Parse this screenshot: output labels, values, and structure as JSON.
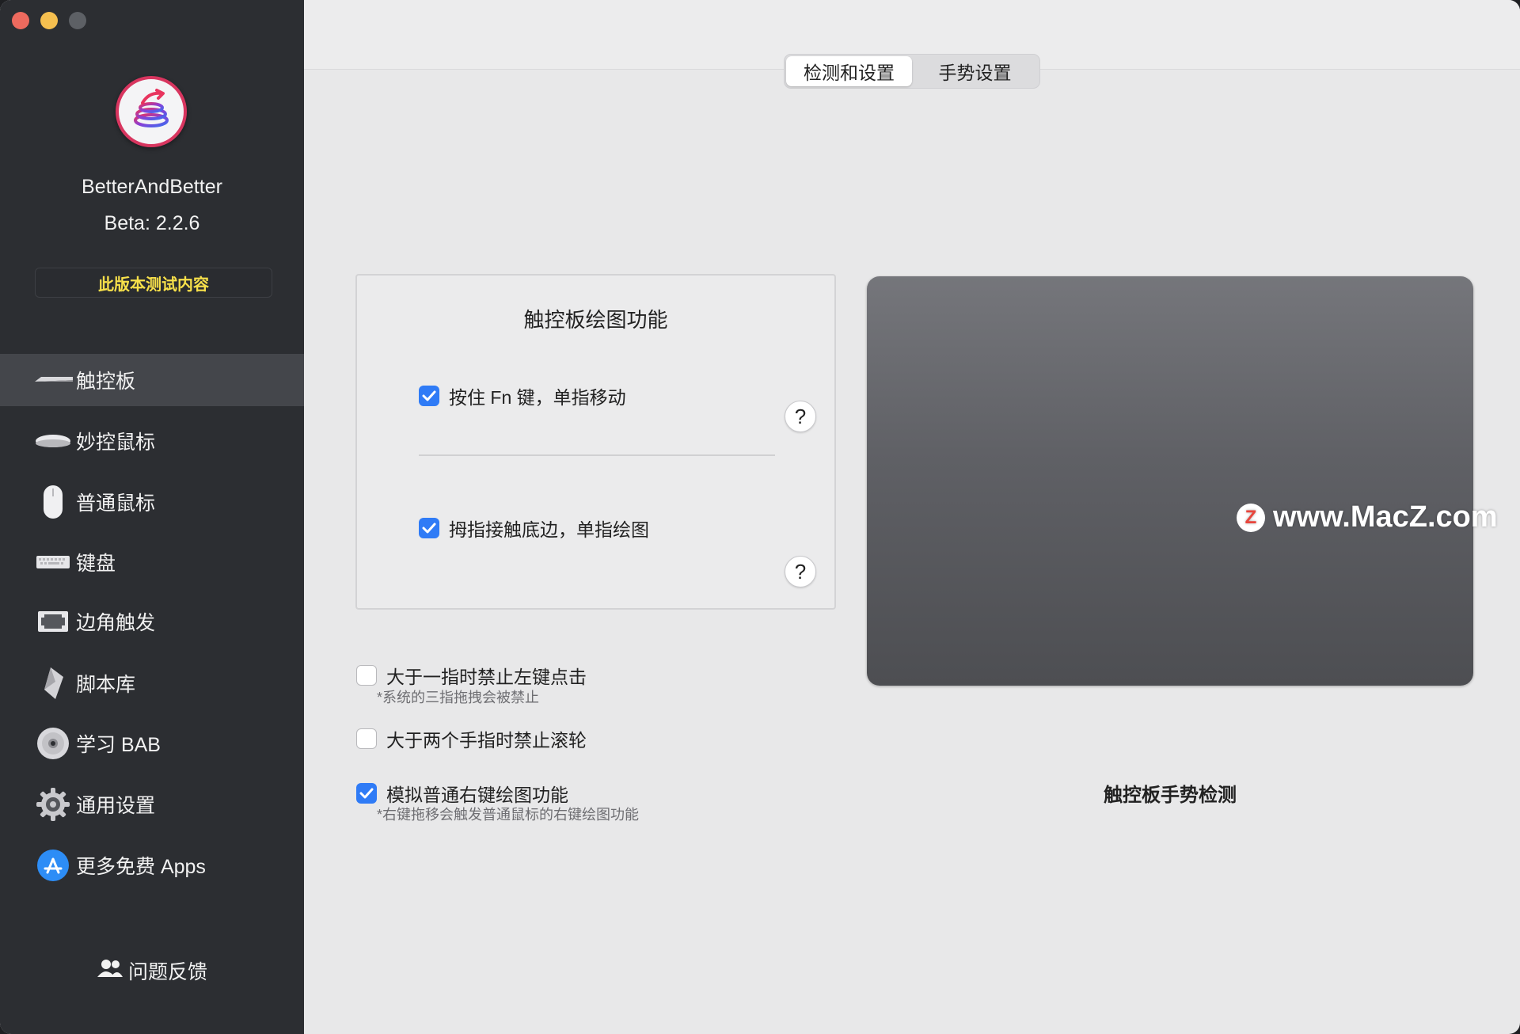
{
  "app": {
    "name": "BetterAndBetter",
    "version": "Beta:  2.2.6",
    "beta_notes": "此版本测试内容"
  },
  "sidebar": {
    "items": [
      {
        "label": "触控板",
        "icon": "trackpad-icon",
        "active": true
      },
      {
        "label": "妙控鼠标",
        "icon": "magic-mouse-icon"
      },
      {
        "label": "普通鼠标",
        "icon": "mouse-icon"
      },
      {
        "label": "键盘",
        "icon": "keyboard-icon"
      },
      {
        "label": "边角触发",
        "icon": "hot-corner-icon"
      },
      {
        "label": "脚本库",
        "icon": "script-icon"
      },
      {
        "label": "学习 BAB",
        "icon": "disc-icon"
      },
      {
        "label": "通用设置",
        "icon": "gear-icon"
      },
      {
        "label": "更多免费 Apps",
        "icon": "app-store-icon"
      }
    ],
    "feedback": "问题反馈"
  },
  "tabs": [
    {
      "label": "检测和设置",
      "active": true
    },
    {
      "label": "手势设置",
      "active": false
    }
  ],
  "drawing_panel": {
    "title": "触控板绘图功能",
    "option1": {
      "label": "按住 Fn 键，单指移动",
      "checked": true
    },
    "option2": {
      "label": "拇指接触底边，单指绘图",
      "checked": true
    },
    "help": "?"
  },
  "options": [
    {
      "label": "大于一指时禁止左键点击",
      "note": "*系统的三指拖拽会被禁止",
      "checked": false
    },
    {
      "label": "大于两个手指时禁止滚轮",
      "note": "",
      "checked": false
    },
    {
      "label": "模拟普通右键绘图功能",
      "note": "*右键拖移会触发普通鼠标的右键绘图功能",
      "checked": true
    }
  ],
  "trackpad": {
    "caption": "触控板手势检测",
    "watermark": "www.MacZ.com",
    "watermark_logo": "Z"
  },
  "colors": {
    "sidebar_bg": "#2c2e32",
    "accent": "#2f7bf6",
    "beta_text": "#f7e04a"
  }
}
